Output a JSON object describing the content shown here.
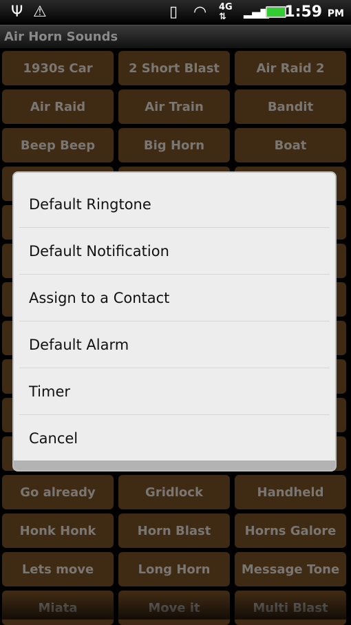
{
  "status_bar": {
    "time": "1:59",
    "ampm": "PM",
    "network": "4G",
    "icons": [
      "usb-icon",
      "warning-icon",
      "vibrate-icon",
      "wifi-icon",
      "4g-icon",
      "signal-icon",
      "battery-charging-icon"
    ]
  },
  "app": {
    "title": "Air Horn Sounds"
  },
  "colors": {
    "button_bg": "#3f2a14",
    "button_text": "#7a7672",
    "dialog_bg": "#ededed"
  },
  "buttons": [
    "1930s Car",
    "2 Short Blast",
    "Air Raid 2",
    "Air Raid",
    "Air Train",
    "Bandit",
    "Beep Beep",
    "Big Horn",
    "Boat",
    "",
    "",
    "",
    "",
    "",
    "",
    "",
    "",
    "",
    "",
    "",
    "",
    "",
    "",
    "",
    "",
    "",
    "",
    "",
    "",
    "",
    "",
    "",
    "",
    "Go already",
    "Gridlock",
    "Handheld",
    "Honk Honk",
    "Horn Blast",
    "Horns Galore",
    "Lets move",
    "Long Horn",
    "Message Tone",
    "Miata",
    "Move it",
    "Multi Blast"
  ],
  "dialog": {
    "items": [
      "Default Ringtone",
      "Default Notification",
      "Assign to a Contact",
      "Default Alarm",
      "Timer",
      "Cancel"
    ]
  }
}
